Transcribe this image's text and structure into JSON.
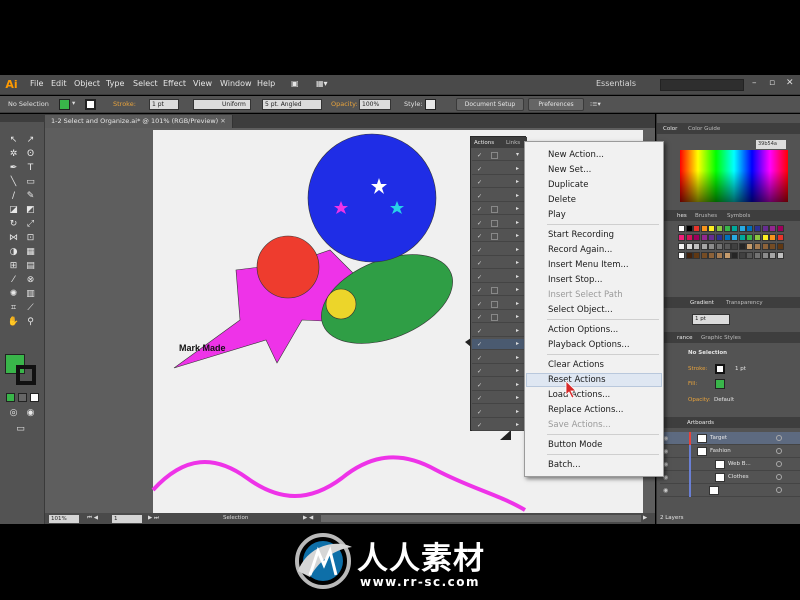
{
  "app": {
    "logo": "Ai",
    "workspace": "Essentials"
  },
  "menubar": {
    "items": [
      "File",
      "Edit",
      "Object",
      "Type",
      "Select",
      "Effect",
      "View",
      "Window",
      "Help"
    ]
  },
  "controlbar": {
    "selection_label": "No Selection",
    "stroke_label": "Stroke:",
    "stroke_value": "1 pt",
    "stroke_profile": "Uniform",
    "brush": "5 pt. Angled",
    "opacity_label": "Opacity:",
    "opacity_value": "100%",
    "style_label": "Style:",
    "document_setup": "Document Setup",
    "preferences": "Preferences"
  },
  "document": {
    "tab_title": "1-2 Select and Organize.ai* @ 101% (RGB/Preview)"
  },
  "artwork": {
    "text_label": "Mark Made"
  },
  "statusbar": {
    "zoom": "101%",
    "artboard": "1",
    "tool": "Selection"
  },
  "actions_panel": {
    "tabs": [
      "Actions",
      "Links"
    ],
    "rows": 21
  },
  "flyout_menu": {
    "items": [
      {
        "label": "New Action...",
        "enabled": true
      },
      {
        "label": "New Set...",
        "enabled": true
      },
      {
        "label": "Duplicate",
        "enabled": true
      },
      {
        "label": "Delete",
        "enabled": true
      },
      {
        "label": "Play",
        "enabled": true
      },
      {
        "label": "Start Recording",
        "enabled": true
      },
      {
        "label": "Record Again...",
        "enabled": true
      },
      {
        "label": "Insert Menu Item...",
        "enabled": true
      },
      {
        "label": "Insert Stop...",
        "enabled": true
      },
      {
        "label": "Insert Select Path",
        "enabled": false
      },
      {
        "label": "Select Object...",
        "enabled": true
      },
      {
        "label": "Action Options...",
        "enabled": true
      },
      {
        "label": "Playback Options...",
        "enabled": true
      },
      {
        "label": "Clear Actions",
        "enabled": true
      },
      {
        "label": "Reset Actions",
        "enabled": true,
        "highlighted": true
      },
      {
        "label": "Load Actions...",
        "enabled": true
      },
      {
        "label": "Replace Actions...",
        "enabled": true
      },
      {
        "label": "Save Actions...",
        "enabled": false
      },
      {
        "label": "Button Mode",
        "enabled": true
      },
      {
        "label": "Batch...",
        "enabled": true
      }
    ]
  },
  "right_panels": {
    "color_tabs": [
      "Color",
      "Color Guide"
    ],
    "hex": "39b54a",
    "swatch_tabs": [
      "hes",
      "Brushes",
      "Symbols"
    ],
    "gradient_tabs": [
      "Gradient",
      "Transparency"
    ],
    "stroke_weight": "1 pt",
    "appearance_tabs": [
      "rance",
      "Graphic Styles"
    ],
    "appearance": {
      "title": "No Selection",
      "stroke_label": "Stroke:",
      "stroke_value": "1 pt",
      "fill_label": "Fill:",
      "opacity_label": "Opacity:",
      "opacity_value": "Default"
    },
    "layers_tab": "Artboards",
    "layers": [
      {
        "name": "Target",
        "color": "#e8423a"
      },
      {
        "name": "Fashion",
        "color": "#6a7fd4"
      },
      {
        "name": "Web B...",
        "color": "#6a7fd4"
      },
      {
        "name": "Clothes",
        "color": "#6a7fd4"
      },
      {
        "name": "<Path>",
        "color": "#6a7fd4"
      }
    ],
    "layers_count": "2 Layers"
  },
  "watermark": {
    "title": "人人素材",
    "url": "www.rr-sc.com"
  },
  "colors": {
    "blue_circle": "#1f2de6",
    "red_circle": "#ee3c2e",
    "magenta": "#ee33e8",
    "green": "#2f9e45",
    "yellow": "#ecd52a",
    "accent_orange": "#e8a33c"
  }
}
